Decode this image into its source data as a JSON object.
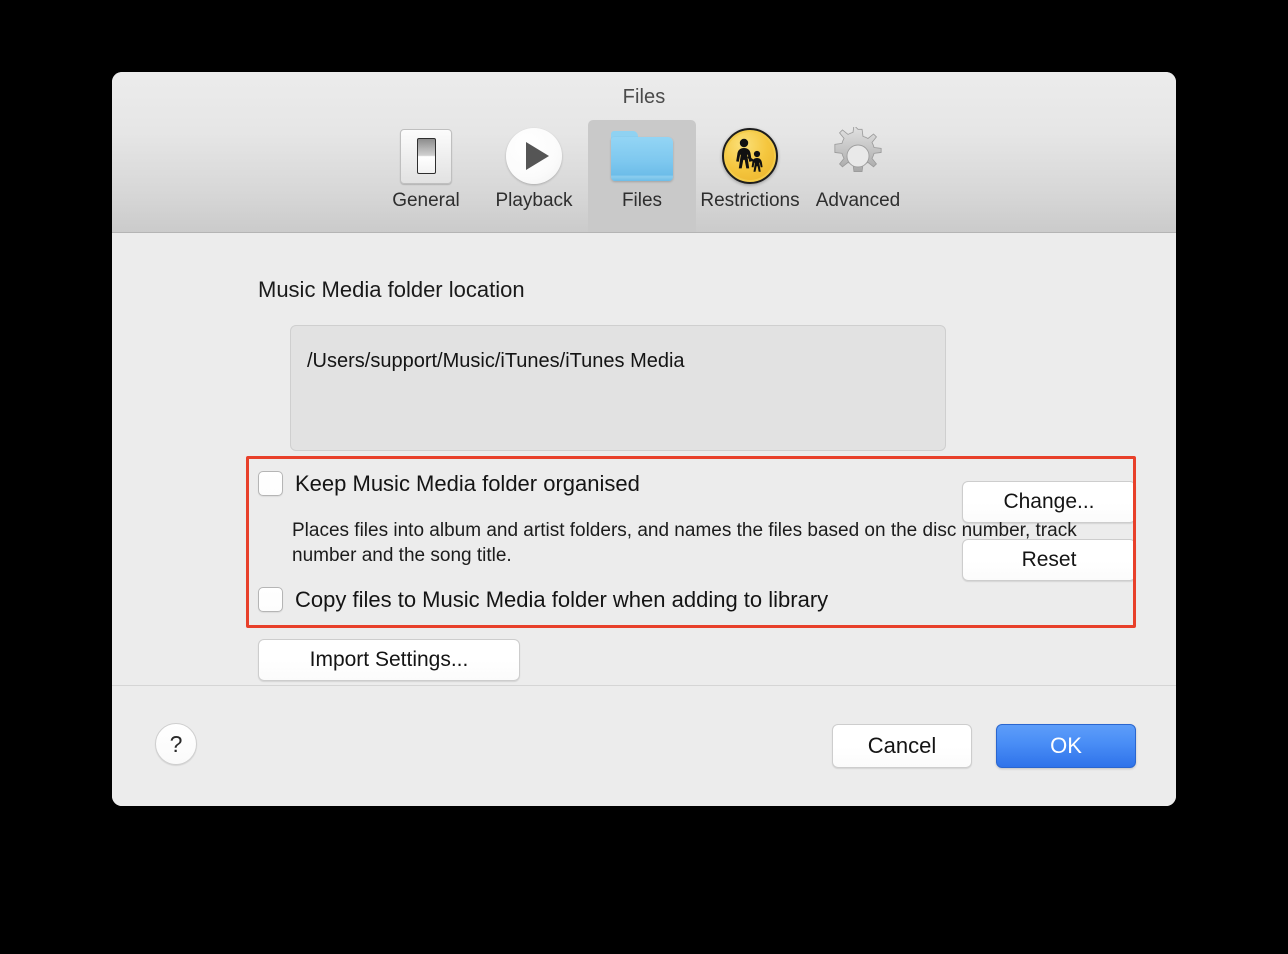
{
  "window": {
    "title": "Files"
  },
  "toolbar": {
    "items": [
      {
        "label": "General",
        "icon": "switch-icon",
        "selected": false
      },
      {
        "label": "Playback",
        "icon": "play-icon",
        "selected": false
      },
      {
        "label": "Files",
        "icon": "folder-icon",
        "selected": true
      },
      {
        "label": "Restrictions",
        "icon": "restrictions-icon",
        "selected": false
      },
      {
        "label": "Advanced",
        "icon": "gear-icon",
        "selected": false
      }
    ]
  },
  "content": {
    "section_label": "Music Media folder location",
    "path_value": "/Users/support/Music/iTunes/iTunes Media",
    "change_label": "Change...",
    "reset_label": "Reset",
    "organise_checkbox": {
      "label": "Keep Music Media folder organised",
      "checked": false,
      "help_text": "Places files into album and artist folders, and names the files based on the disc number, track number and the song title."
    },
    "copy_checkbox": {
      "label": "Copy files to Music Media folder when adding to library",
      "checked": false
    },
    "import_settings_label": "Import Settings...",
    "highlight_color": "#e8402a"
  },
  "footer": {
    "help_label": "?",
    "cancel_label": "Cancel",
    "ok_label": "OK",
    "ok_accent_color": "#3d82f2"
  }
}
